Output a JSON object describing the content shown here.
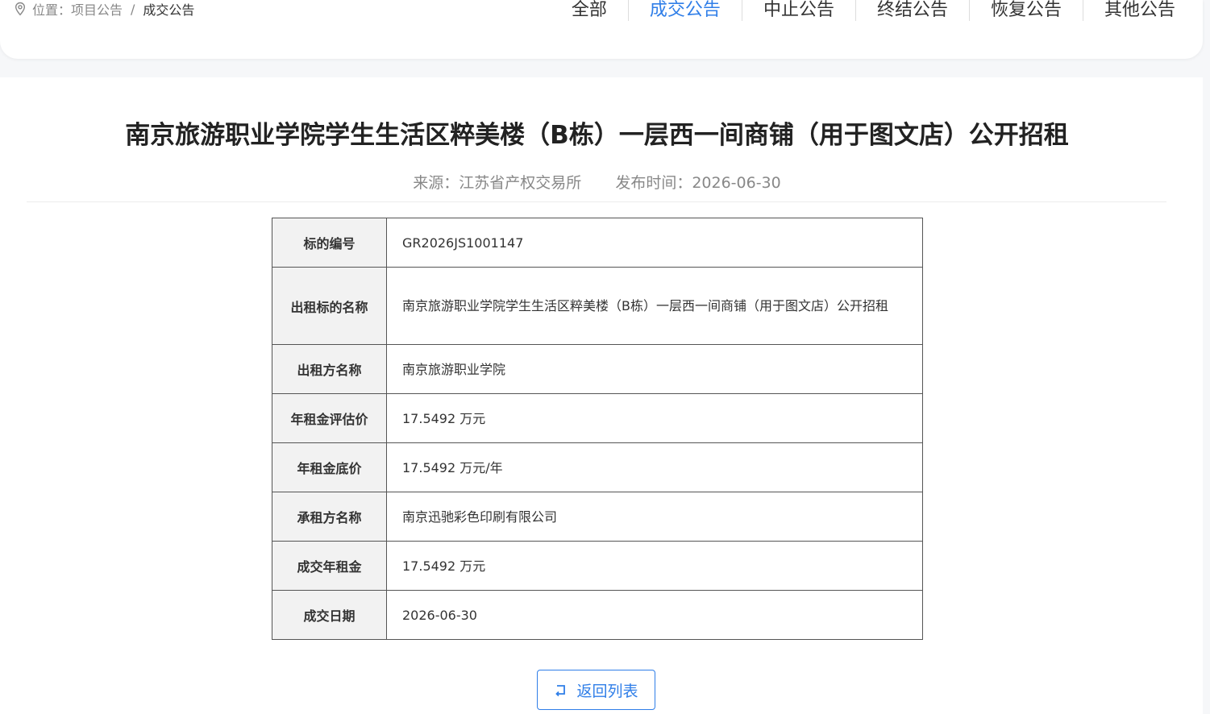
{
  "breadcrumb": {
    "prefix": "位置：",
    "parent": "项目公告",
    "separator": "/",
    "current": "成交公告"
  },
  "tabs": [
    {
      "label": "全部",
      "active": false
    },
    {
      "label": "成交公告",
      "active": true
    },
    {
      "label": "中止公告",
      "active": false
    },
    {
      "label": "终结公告",
      "active": false
    },
    {
      "label": "恢复公告",
      "active": false
    },
    {
      "label": "其他公告",
      "active": false
    }
  ],
  "article": {
    "title": "南京旅游职业学院学生生活区粹美楼（B栋）一层西一间商铺（用于图文店）公开招租",
    "source": "来源：江苏省产权交易所",
    "publish_time": "发布时间：2026-06-30"
  },
  "table": [
    {
      "key": "标的编号",
      "value": "GR2026JS1001147"
    },
    {
      "key": "出租标的名称",
      "value": "南京旅游职业学院学生生活区粹美楼（B栋）一层西一间商铺（用于图文店）公开招租"
    },
    {
      "key": "出租方名称",
      "value": "南京旅游职业学院"
    },
    {
      "key": "年租金评估价",
      "value": "17.5492 万元"
    },
    {
      "key": "年租金底价",
      "value": "17.5492 万元/年"
    },
    {
      "key": "承租方名称",
      "value": "南京迅驰彩色印刷有限公司"
    },
    {
      "key": "成交年租金",
      "value": "17.5492 万元"
    },
    {
      "key": "成交日期",
      "value": "2026-06-30"
    }
  ],
  "back_button": {
    "label": "返回列表",
    "icon": "return-icon"
  },
  "colors": {
    "accent": "#2f7ee8",
    "label_bg": "#f2f2f2",
    "border": "#555555"
  }
}
